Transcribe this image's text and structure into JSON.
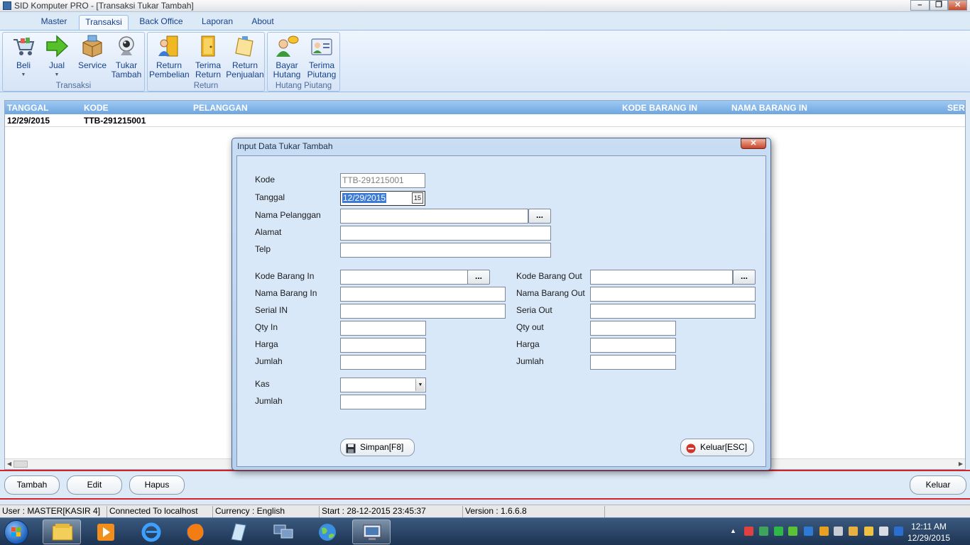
{
  "window": {
    "title": "SID Komputer PRO - [Transaksi Tukar Tambah]",
    "min_icon": "minimize-icon",
    "max_icon": "restore-icon",
    "close_icon": "close-icon"
  },
  "menu": {
    "tabs": [
      "Master",
      "Transaksi",
      "Back Office",
      "Laporan",
      "About"
    ],
    "active": "Transaksi"
  },
  "ribbon": {
    "groups": [
      {
        "title": "Transaksi",
        "buttons": [
          {
            "label": "Beli",
            "icon": "shopping-cart-icon"
          },
          {
            "label": "Jual",
            "icon": "green-arrow-icon"
          },
          {
            "label": "Service",
            "icon": "box-icon"
          },
          {
            "label1": "Tukar",
            "label2": "Tambah",
            "icon": "webcam-icon"
          }
        ]
      },
      {
        "title": "Return",
        "buttons": [
          {
            "label1": "Return",
            "label2": "Pembelian",
            "icon": "user-door-icon"
          },
          {
            "label1": "Terima",
            "label2": "Return",
            "icon": "door-icon"
          },
          {
            "label1": "Return",
            "label2": "Penjualan",
            "icon": "note-pad-icon"
          }
        ]
      },
      {
        "title": "Hutang Piutang",
        "buttons": [
          {
            "label1": "Bayar",
            "label2": "Hutang",
            "icon": "user-chat-icon"
          },
          {
            "label1": "Terima",
            "label2": "Piutang",
            "icon": "id-card-icon"
          }
        ]
      }
    ]
  },
  "grid": {
    "headers": [
      "TANGGAL",
      "KODE",
      "PELANGGAN",
      "KODE BARANG IN",
      "NAMA BARANG IN",
      "SER"
    ],
    "rows": [
      {
        "tanggal": "12/29/2015",
        "kode": "TTB-291215001"
      }
    ]
  },
  "toolbar": {
    "tambah": "Tambah",
    "edit": "Edit",
    "hapus": "Hapus",
    "keluar": "Keluar"
  },
  "status": {
    "user": "User : MASTER[KASIR 4]",
    "connection": "Connected To localhost",
    "currency": "Currency : English",
    "start": "Start  : 28-12-2015 23:45:37",
    "version": "Version : 1.6.6.8"
  },
  "taskbar": {
    "time": "12:11 AM",
    "date": "12/29/2015"
  },
  "dialog": {
    "title": "Input Data Tukar Tambah",
    "fields": {
      "kode": {
        "label": "Kode",
        "value": "TTB-291215001"
      },
      "tanggal": {
        "label": "Tanggal",
        "value": "12/29/2015"
      },
      "nama_pelanggan": {
        "label": "Nama Pelanggan",
        "value": ""
      },
      "alamat": {
        "label": "Alamat",
        "value": ""
      },
      "telp": {
        "label": "Telp",
        "value": ""
      },
      "kode_barang_in": {
        "label": "Kode Barang In",
        "value": ""
      },
      "nama_barang_in": {
        "label": "Nama Barang In",
        "value": ""
      },
      "serial_in": {
        "label": "Serial IN",
        "value": ""
      },
      "qty_in": {
        "label": "Qty In",
        "value": ""
      },
      "harga_in": {
        "label": "Harga",
        "value": ""
      },
      "jumlah_in": {
        "label": "Jumlah",
        "value": ""
      },
      "kode_barang_out": {
        "label": "Kode Barang Out",
        "value": ""
      },
      "nama_barang_out": {
        "label": "Nama Barang Out",
        "value": ""
      },
      "seria_out": {
        "label": "Seria Out",
        "value": ""
      },
      "qty_out": {
        "label": "Qty out",
        "value": ""
      },
      "harga_out": {
        "label": "Harga",
        "value": ""
      },
      "jumlah_out": {
        "label": "Jumlah",
        "value": ""
      },
      "kas": {
        "label": "Kas",
        "value": ""
      },
      "jumlah_total": {
        "label": "Jumlah",
        "value": ""
      }
    },
    "browse_label": "...",
    "calendar_glyph": "15",
    "simpan": "Simpan[F8]",
    "keluar": "Keluar[ESC]"
  }
}
